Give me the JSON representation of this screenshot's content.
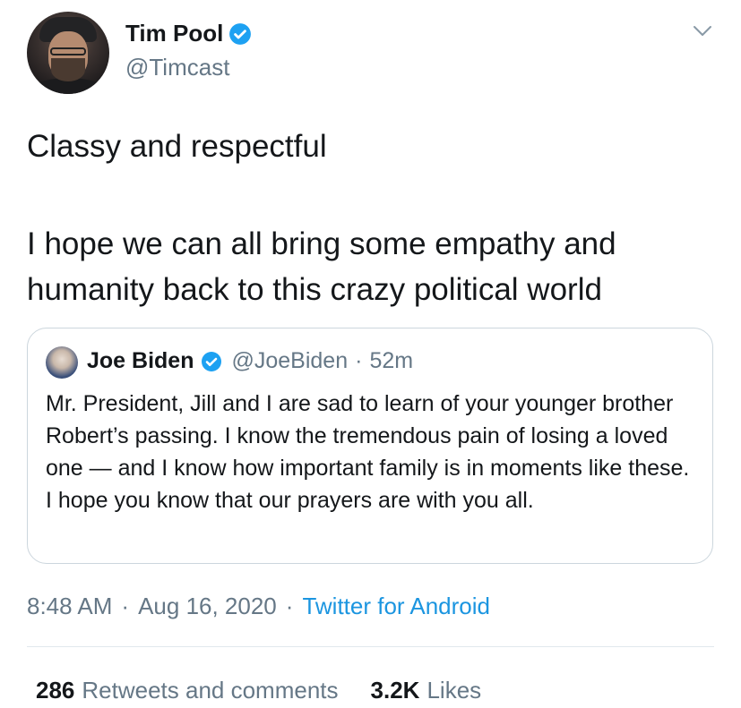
{
  "author": {
    "name": "Tim Pool",
    "handle": "@Timcast",
    "verified_icon": "verified-badge-icon"
  },
  "menu_icon": "chevron-down-icon",
  "tweet": {
    "line1": "Classy and respectful",
    "line2": "I hope we can all bring some empathy and humanity back to this crazy political world"
  },
  "quoted_tweet": {
    "name": "Joe Biden",
    "handle": "@JoeBiden",
    "separator": "·",
    "time": "52m",
    "text": "Mr. President, Jill and I are sad to learn of your younger brother Robert’s passing. I know the tremendous pain of losing a loved one — and I know how important family is in moments like these. I hope you know that our prayers are with you all."
  },
  "meta": {
    "time": "8:48 AM",
    "separator": "·",
    "date": "Aug 16, 2020",
    "source": "Twitter for Android"
  },
  "stats": {
    "retweets_count": "286",
    "retweets_label": "Retweets and comments",
    "likes_count": "3.2K",
    "likes_label": "Likes"
  },
  "colors": {
    "accent": "#1b95e0",
    "secondary_text": "#657786",
    "border": "#ccd6dd"
  }
}
